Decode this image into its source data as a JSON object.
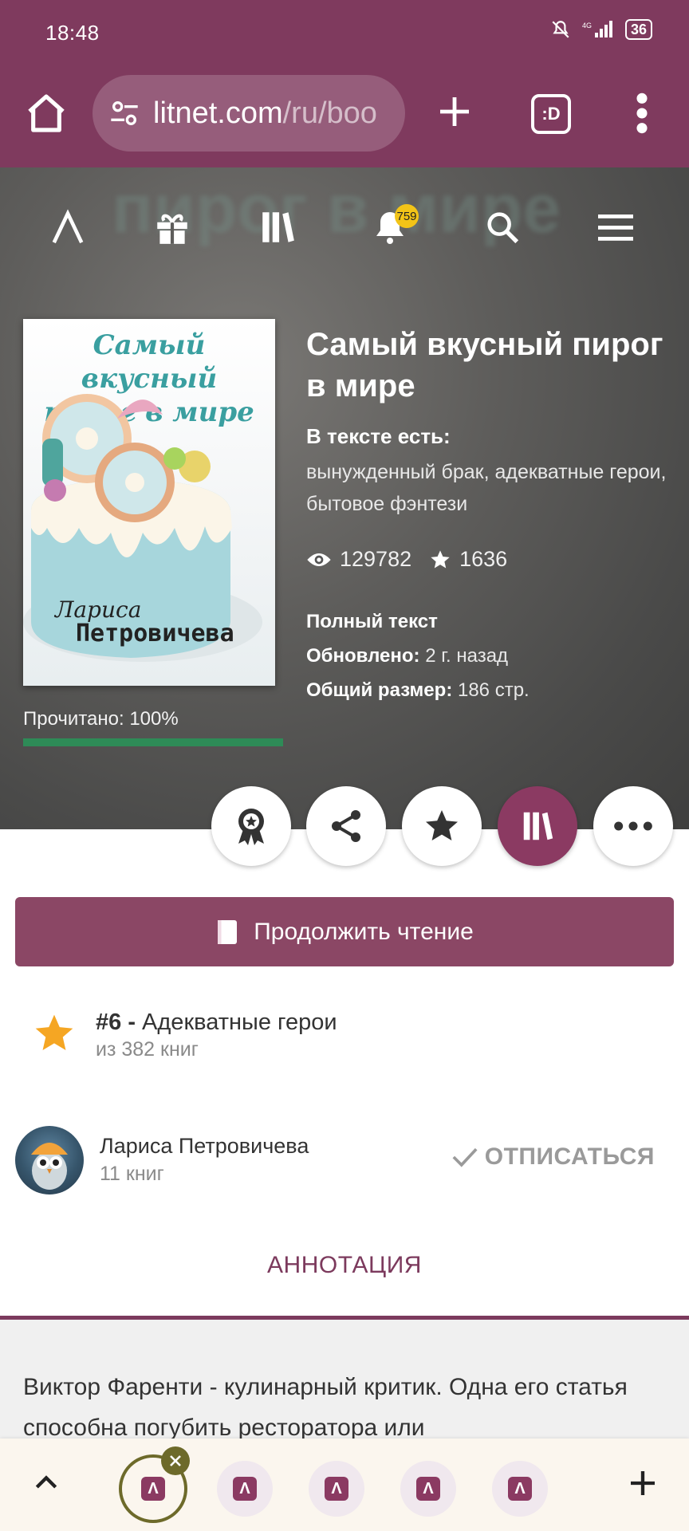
{
  "status": {
    "time": "18:48",
    "battery": "36"
  },
  "browser": {
    "url_domain": "litnet.com",
    "url_path": "/ru/boo",
    "tabs_label": ":D"
  },
  "hero": {
    "ghost_text": "пирог в мире"
  },
  "nav": {
    "notifications": "759"
  },
  "book": {
    "title": "Самый вкусный пирог в мире",
    "cover_title": "Самый вкусный пирог в мире",
    "cover_author_first": "Лариса",
    "cover_author_last": "Петровичева",
    "tags_heading": "В тексте есть:",
    "tags": "вынужденный брак, адекватные герои, бытовое фэнтези",
    "views": "129782",
    "likes": "1636",
    "status": "Полный текст",
    "updated_label": "Обновлено:",
    "updated_value": "2 г. назад",
    "size_label": "Общий размер:",
    "size_value": "186 стр.",
    "read_progress_label": "Прочитано: 100%",
    "read_progress": 1.0
  },
  "continue_button": "Продолжить чтение",
  "rank": {
    "position": "#6 -",
    "genre": "Адекватные герои",
    "of": "из 382 книг"
  },
  "author": {
    "name": "Лариса Петровичева",
    "books": "11 книг",
    "unsubscribe": "ОТПИСАТЬСЯ"
  },
  "annotation": {
    "tab": "АННОТАЦИЯ",
    "text": "Виктор Фаренти - кулинарный критик. Одна его статья способна погубить ресторатора или"
  },
  "colors": {
    "brand": "#7f3a5e",
    "accent_button": "#8b4765",
    "progress": "#2e8b57",
    "star": "#f5a623"
  }
}
